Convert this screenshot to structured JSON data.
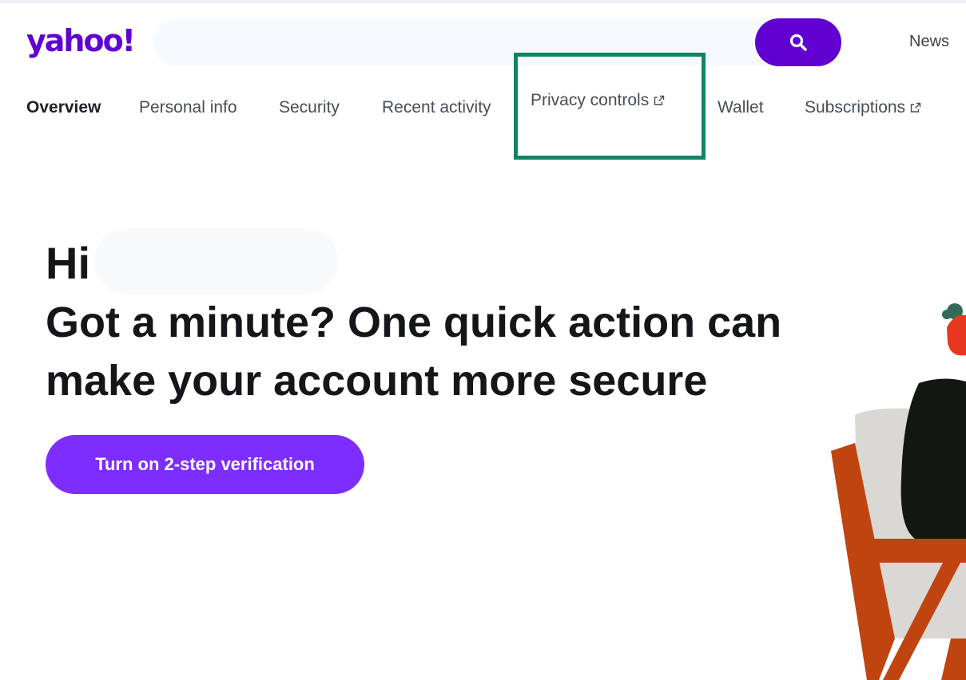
{
  "header": {
    "logo": "yahoo!",
    "search": {
      "value": "",
      "placeholder": ""
    },
    "news_label": "News"
  },
  "nav": {
    "items": [
      {
        "label": "Overview",
        "active": true,
        "external": false
      },
      {
        "label": "Personal info",
        "active": false,
        "external": false
      },
      {
        "label": "Security",
        "active": false,
        "external": false
      },
      {
        "label": "Recent activity",
        "active": false,
        "external": false
      },
      {
        "label": "Privacy controls",
        "active": false,
        "external": true,
        "highlighted": true
      },
      {
        "label": "Wallet",
        "active": false,
        "external": false
      },
      {
        "label": "Subscriptions",
        "active": false,
        "external": true
      }
    ]
  },
  "hero": {
    "greeting": "Hi",
    "headline": "Got a minute? One quick action can make your account more secure",
    "cta_label": "Turn on 2-step verification"
  },
  "colors": {
    "brand": "#6001d2",
    "cta": "#7d2eff",
    "highlight_border": "#0f8464",
    "illustration_chair": "#c0440f"
  },
  "icons": [
    "search-icon",
    "external-link-icon"
  ]
}
